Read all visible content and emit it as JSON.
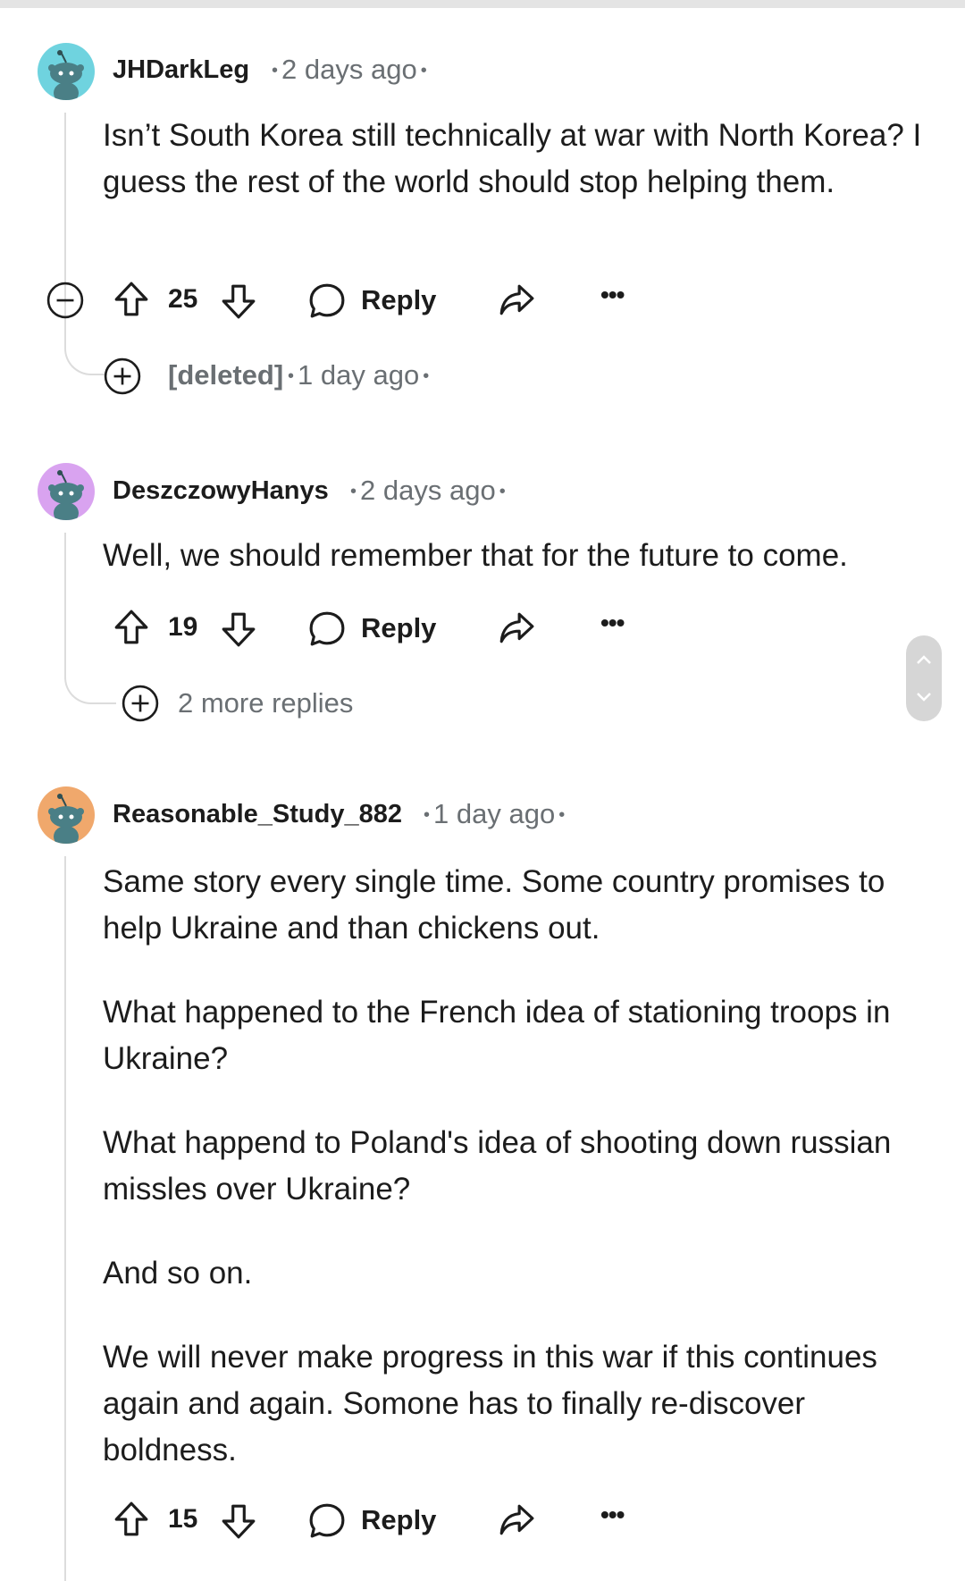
{
  "comments": [
    {
      "username": "JHDarkLeg",
      "time": "2 days ago",
      "avatar_color": "#6fd3df",
      "paragraphs": [
        "Isn’t South Korea still technically at war with North Korea? I guess the rest of the world should stop helping them."
      ],
      "votes": "25",
      "reply_label": "Reply",
      "collapsed_reply": {
        "username": "[deleted]",
        "time": "1 day ago"
      }
    },
    {
      "username": "DeszczowyHanys",
      "time": "2 days ago",
      "avatar_color": "#d9a3f0",
      "paragraphs": [
        "Well, we should remember that for the future to come."
      ],
      "votes": "19",
      "reply_label": "Reply",
      "more_replies": "2 more replies"
    },
    {
      "username": "Reasonable_Study_882",
      "time": "1 day ago",
      "avatar_color": "#f0a86c",
      "paragraphs": [
        "Same story every single time. Some country promises to help Ukraine and than chickens out.",
        "What happened to the French idea of stationing troops in Ukraine?",
        "What happend to Poland's idea of shooting down russian missles over Ukraine?",
        "And so on.",
        "We will never make progress in this war if this continues again and again. Somone has to finally re-discover boldness."
      ],
      "votes": "15",
      "reply_label": "Reply"
    }
  ],
  "icons": {
    "upvote": "arrow-up-outline",
    "downvote": "arrow-down-outline",
    "reply": "speech-bubble",
    "share": "share-arrow",
    "more": "ellipsis",
    "collapse": "minus-circle",
    "expand": "plus-circle"
  },
  "colors": {
    "thread_line": "#dcdcdc",
    "meta_text": "#6a6f73"
  }
}
